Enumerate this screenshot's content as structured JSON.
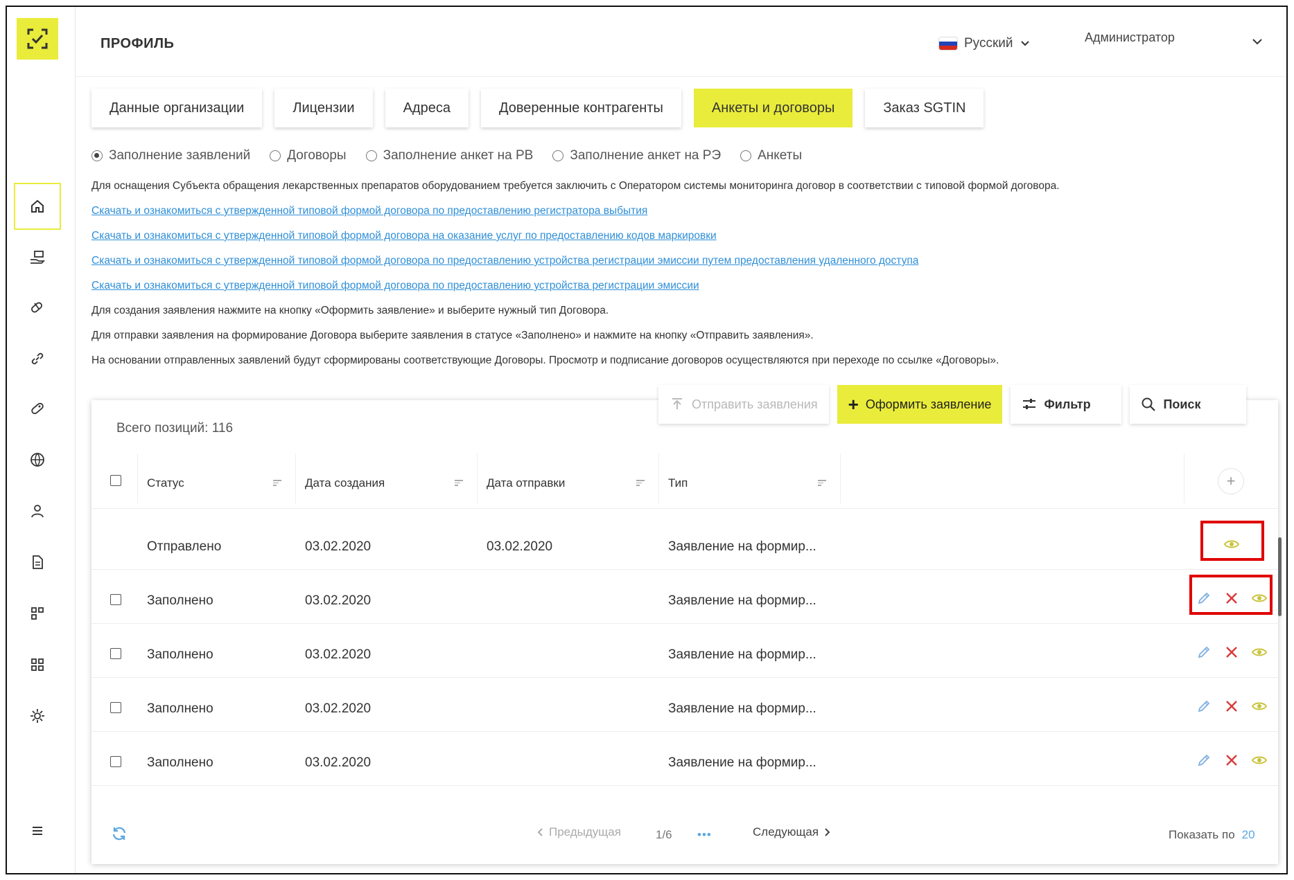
{
  "header": {
    "title": "ПРОФИЛЬ",
    "language": "Русский",
    "user": "Администратор"
  },
  "tabs": [
    {
      "label": "Данные организации",
      "active": false
    },
    {
      "label": "Лицензии",
      "active": false
    },
    {
      "label": "Адреса",
      "active": false
    },
    {
      "label": "Доверенные контрагенты",
      "active": false
    },
    {
      "label": "Анкеты и договоры",
      "active": true
    },
    {
      "label": "Заказ SGTIN",
      "active": false
    }
  ],
  "radios": [
    {
      "label": "Заполнение заявлений",
      "checked": true
    },
    {
      "label": "Договоры",
      "checked": false
    },
    {
      "label": "Заполнение анкет на РВ",
      "checked": false
    },
    {
      "label": "Заполнение анкет на РЭ",
      "checked": false
    },
    {
      "label": "Анкеты",
      "checked": false
    }
  ],
  "info": {
    "intro": "Для оснащения Субъекта обращения лекарственных препаратов оборудованием требуется заключить с Оператором системы мониторинга договор в соответствии с типовой формой договора.",
    "links": [
      "Скачать и ознакомиться с утвержденной типовой формой договора по предоставлению регистратора выбытия",
      "Скачать и ознакомиться с утвержденной типовой формой договора на оказание услуг по предоставлению кодов маркировки",
      "Скачать и ознакомиться с утвержденной типовой формой договора по предоставлению устройства регистрации эмиссии путем предоставления удаленного доступа",
      "Скачать и ознакомиться с утвержденной типовой формой договора по предоставлению устройства регистрации эмиссии"
    ],
    "notes": [
      "Для создания заявления нажмите на кнопку «Оформить заявление» и выберите нужный тип Договора.",
      "Для отправки заявления на формирование Договора выберите заявления в статусе «Заполнено» и нажмите на кнопку «Отправить заявления».",
      "На основании отправленных заявлений будут сформированы соответствующие Договоры. Просмотр и подписание договоров осуществляются при переходе по ссылке «Договоры»."
    ]
  },
  "actions": {
    "send": "Отправить заявления",
    "create": "Оформить заявление",
    "filter": "Фильтр",
    "search": "Поиск"
  },
  "table": {
    "total_label": "Всего позиций: 116",
    "columns": [
      "Статус",
      "Дата создания",
      "Дата отправки",
      "Тип"
    ],
    "rows": [
      {
        "status": "Отправлено",
        "created": "03.02.2020",
        "sent": "03.02.2020",
        "type": "Заявление на формир..."
      },
      {
        "status": "Заполнено",
        "created": "03.02.2020",
        "sent": "",
        "type": "Заявление на формир..."
      },
      {
        "status": "Заполнено",
        "created": "03.02.2020",
        "sent": "",
        "type": "Заявление на формир..."
      },
      {
        "status": "Заполнено",
        "created": "03.02.2020",
        "sent": "",
        "type": "Заявление на формир..."
      },
      {
        "status": "Заполнено",
        "created": "03.02.2020",
        "sent": "",
        "type": "Заявление на формир..."
      }
    ]
  },
  "pagination": {
    "prev": "Предыдущая",
    "page": "1/6",
    "ellipsis": "•••",
    "next": "Следующая",
    "show_per_label": "Показать по",
    "per_page": "20"
  },
  "colors": {
    "accent": "#e9ec3a",
    "link": "#2f8fd8",
    "delete": "#d93a3a",
    "edit": "#7fb0e0",
    "view": "#c9c33a",
    "highlight": "#e00000"
  }
}
